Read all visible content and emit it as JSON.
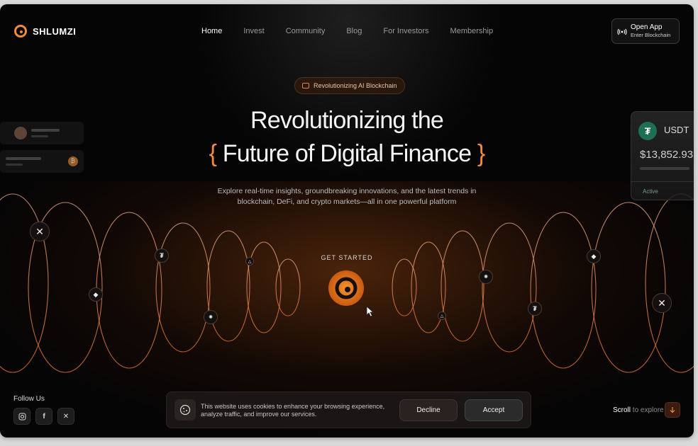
{
  "brand": {
    "name": "SHLUMZI",
    "accent": "#f08c3a"
  },
  "nav": {
    "items": [
      {
        "label": "Home",
        "active": true
      },
      {
        "label": "Invest"
      },
      {
        "label": "Community"
      },
      {
        "label": "Blog"
      },
      {
        "label": "For Investors"
      },
      {
        "label": "Membership"
      }
    ]
  },
  "open_app": {
    "title": "Open App",
    "subtitle": "Enter Blockchain"
  },
  "hero": {
    "badge": "Revolutionizing AI Blockchain",
    "title_line1": "Revolutionizing the",
    "title_line2": "Future of Digital Finance",
    "brace_open": "{",
    "brace_close": "}",
    "subtitle": "Explore real-time insights, groundbreaking innovations, and the latest trends in blockchain, DeFi, and crypto markets—all in one powerful platform",
    "cta_label": "GET STARTED"
  },
  "side_card": {
    "symbol": "USDT",
    "amount": "$13,852.93",
    "status": "Active"
  },
  "footer": {
    "follow_label": "Follow Us",
    "socials": [
      "instagram-icon",
      "facebook-icon",
      "x-icon"
    ],
    "cookie_text": "This website uses cookies to enhance your browsing experience, analyze traffic, and improve our services.",
    "decline_label": "Decline",
    "accept_label": "Accept",
    "scroll_label": "Scroll",
    "scroll_suffix": " to explore"
  }
}
